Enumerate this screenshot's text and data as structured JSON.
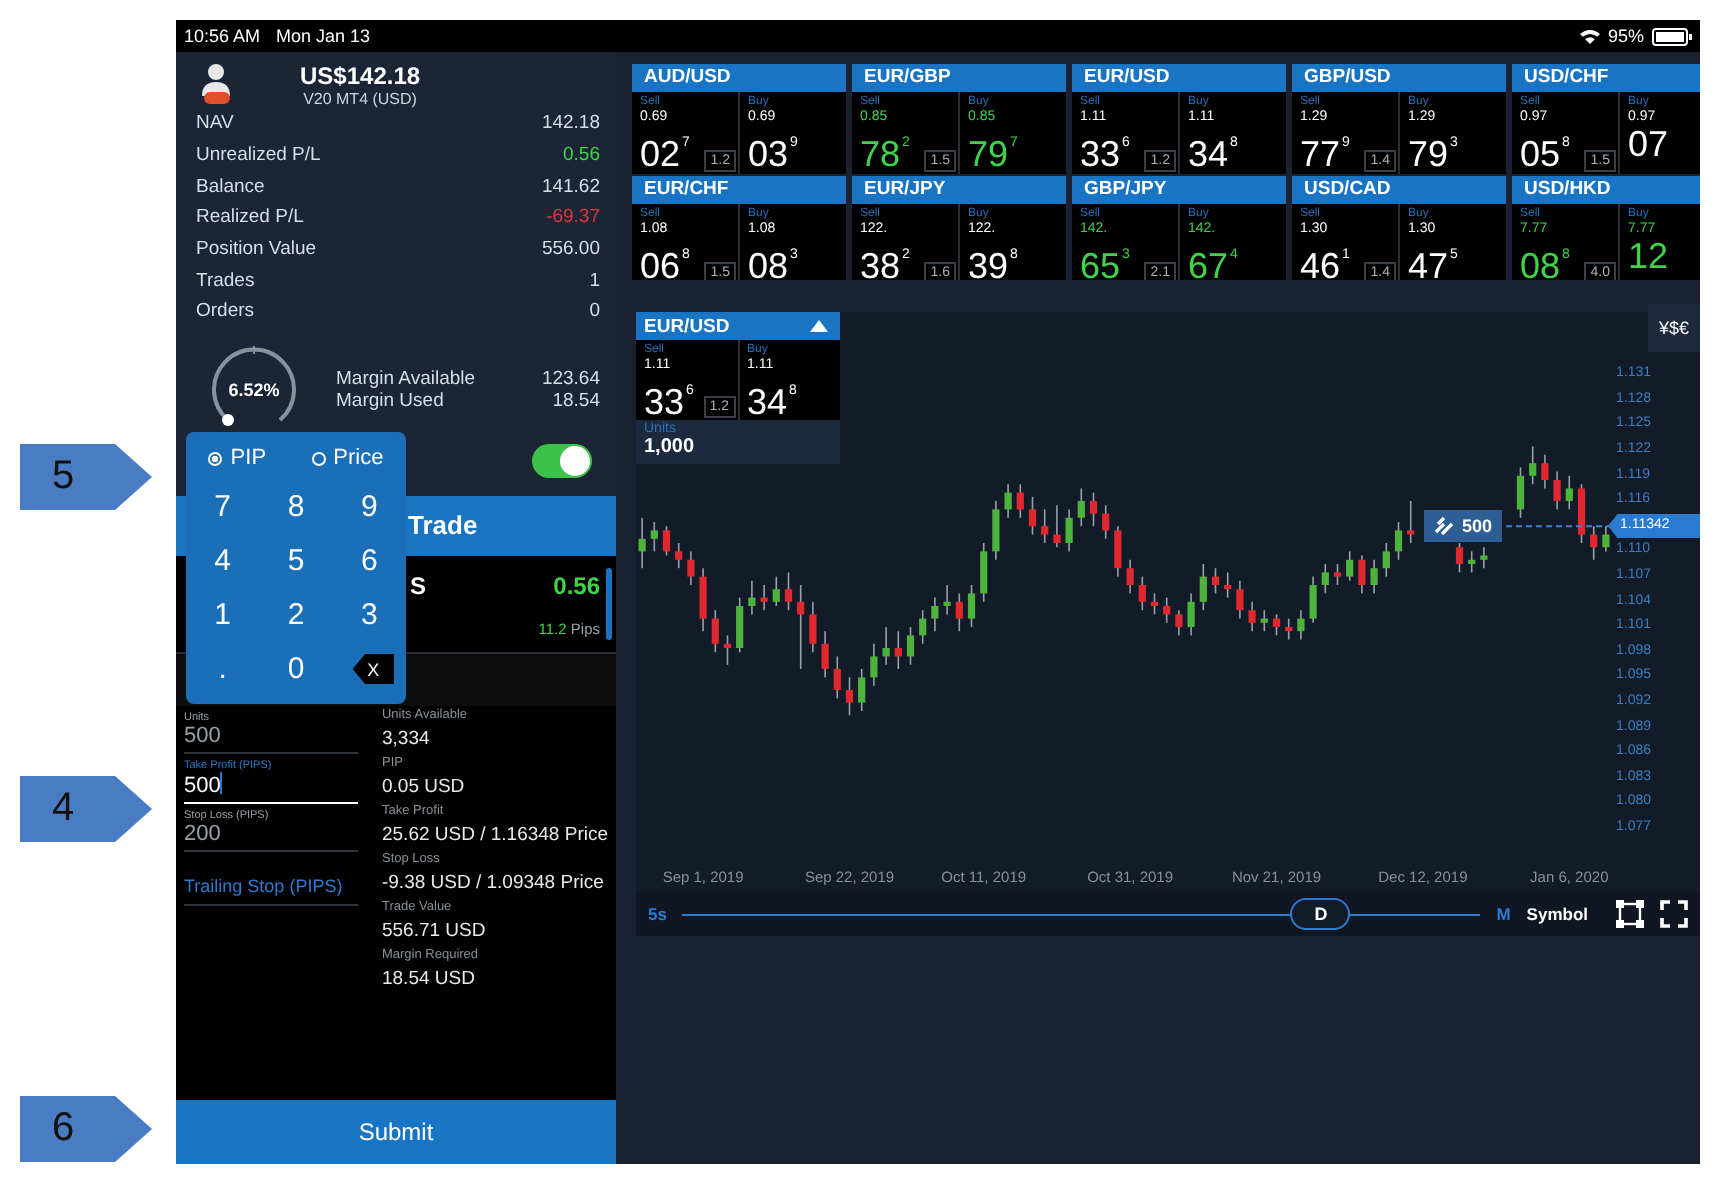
{
  "status_bar": {
    "time": "10:56 AM",
    "date": "Mon Jan 13",
    "battery": "95%"
  },
  "callouts": [
    {
      "label": "5"
    },
    {
      "label": "4"
    },
    {
      "label": "6"
    }
  ],
  "account": {
    "balance_title": "US$142.18",
    "account_name": "V20 MT4 (USD)",
    "rows": [
      {
        "label": "NAV",
        "value": "142.18",
        "color": "#d8dde6"
      },
      {
        "label": "Unrealized P/L",
        "value": "0.56",
        "color": "#3fd44a"
      },
      {
        "label": "Balance",
        "value": "141.62",
        "color": "#d8dde6"
      },
      {
        "label": "Realized P/L",
        "value": "-69.37",
        "color": "#e3343a"
      },
      {
        "label": "Position Value",
        "value": "556.00",
        "color": "#d8dde6"
      },
      {
        "label": "Trades",
        "value": "1",
        "color": "#d8dde6"
      },
      {
        "label": "Orders",
        "value": "0",
        "color": "#d8dde6"
      }
    ],
    "margin": {
      "percent": "6.52%",
      "items": [
        {
          "label": "Margin Available",
          "value": "123.64"
        },
        {
          "label": "Margin Used",
          "value": "18.54"
        }
      ]
    }
  },
  "toggle": {
    "on": true
  },
  "keypad": {
    "modes": [
      {
        "label": "PIP",
        "selected": true
      },
      {
        "label": "Price",
        "selected": false
      }
    ],
    "keys": [
      "7",
      "8",
      "9",
      "4",
      "5",
      "6",
      "1",
      "2",
      "3",
      ".",
      "0"
    ],
    "backspace": "X"
  },
  "trade": {
    "header": "Trade",
    "position_label": "S",
    "pl": "0.56",
    "pips_value": "11.2",
    "pips_unit": "Pips"
  },
  "order_form": {
    "fields": [
      {
        "label": "Units",
        "value": "500",
        "focused": false
      },
      {
        "label": "Take Profit (PIPS)",
        "value": "500",
        "focused": true
      },
      {
        "label": "Stop Loss (PIPS)",
        "value": "200",
        "focused": false
      }
    ],
    "trailing_stop": "Trailing Stop (PIPS)",
    "info": [
      {
        "label": "Units Available",
        "value": "3,334"
      },
      {
        "label": "PIP",
        "value": "0.05 USD"
      },
      {
        "label": "Take Profit",
        "value": "25.62 USD / 1.16348 Price"
      },
      {
        "label": "Stop Loss",
        "value": "-9.38 USD / 1.09348 Price"
      },
      {
        "label": "Trade Value",
        "value": "556.71 USD"
      },
      {
        "label": "Margin Required",
        "value": "18.54 USD"
      }
    ]
  },
  "submit": "Submit",
  "quotes": [
    {
      "pair": "AUD/USD",
      "rising": false,
      "spread": "1.2",
      "sell": {
        "label": "Sell",
        "prefix": "0.69",
        "big": "02",
        "pip": "7"
      },
      "buy": {
        "label": "Buy",
        "prefix": "0.69",
        "big": "03",
        "pip": "9"
      }
    },
    {
      "pair": "EUR/GBP",
      "rising": true,
      "spread": "1.5",
      "sell": {
        "label": "Sell",
        "prefix": "0.85",
        "big": "78",
        "pip": "2"
      },
      "buy": {
        "label": "Buy",
        "prefix": "0.85",
        "big": "79",
        "pip": "7"
      }
    },
    {
      "pair": "EUR/USD",
      "rising": false,
      "spread": "1.2",
      "sell": {
        "label": "Sell",
        "prefix": "1.11",
        "big": "33",
        "pip": "6"
      },
      "buy": {
        "label": "Buy",
        "prefix": "1.11",
        "big": "34",
        "pip": "8"
      }
    },
    {
      "pair": "GBP/USD",
      "rising": false,
      "spread": "1.4",
      "sell": {
        "label": "Sell",
        "prefix": "1.29",
        "big": "77",
        "pip": "9"
      },
      "buy": {
        "label": "Buy",
        "prefix": "1.29",
        "big": "79",
        "pip": "3"
      }
    },
    {
      "pair": "USD/CHF",
      "rising": false,
      "spread": "1.5",
      "sell": {
        "label": "Sell",
        "prefix": "0.97",
        "big": "05",
        "pip": "8"
      },
      "buy": {
        "label": "Buy",
        "prefix": "0.97",
        "big": "07"
      }
    },
    {
      "pair": "EUR/CHF",
      "rising": false,
      "spread": "1.5",
      "sell": {
        "label": "Sell",
        "prefix": "1.08",
        "big": "06",
        "pip": "8"
      },
      "buy": {
        "label": "Buy",
        "prefix": "1.08",
        "big": "08",
        "pip": "3"
      }
    },
    {
      "pair": "EUR/JPY",
      "rising": false,
      "spread": "1.6",
      "sell": {
        "label": "Sell",
        "prefix": "122.",
        "big": "38",
        "pip": "2"
      },
      "buy": {
        "label": "Buy",
        "prefix": "122.",
        "big": "39",
        "pip": "8"
      }
    },
    {
      "pair": "GBP/JPY",
      "rising": true,
      "spread": "2.1",
      "sell": {
        "label": "Sell",
        "prefix": "142.",
        "big": "65",
        "pip": "3"
      },
      "buy": {
        "label": "Buy",
        "prefix": "142.",
        "big": "67",
        "pip": "4"
      }
    },
    {
      "pair": "USD/CAD",
      "rising": false,
      "spread": "1.4",
      "sell": {
        "label": "Sell",
        "prefix": "1.30",
        "big": "46",
        "pip": "1"
      },
      "buy": {
        "label": "Buy",
        "prefix": "1.30",
        "big": "47",
        "pip": "5"
      }
    },
    {
      "pair": "USD/HKD",
      "rising": true,
      "spread": "4.0",
      "sell": {
        "label": "Sell",
        "prefix": "7.77",
        "big": "08",
        "pip": "8"
      },
      "buy": {
        "label": "Buy",
        "prefix": "7.77",
        "big": "12"
      }
    }
  ],
  "chart": {
    "ticket": {
      "pair": "EUR/USD",
      "spread": "1.2",
      "sell": {
        "label": "Sell",
        "prefix": "1.11",
        "big": "33",
        "pip": "6"
      },
      "buy": {
        "label": "Buy",
        "prefix": "1.11",
        "big": "34",
        "pip": "8"
      },
      "units_label": "Units",
      "units": "1,000"
    },
    "currency_button": "¥$€",
    "price_tag": "1.11342",
    "position_marker": "500",
    "timeframe": {
      "min": "5s",
      "current": "D",
      "max": "M",
      "level": 0.8
    },
    "symbol": "Symbol",
    "chart_data": {
      "type": "candlestick",
      "ylim": [
        1.077,
        1.131
      ],
      "categories": [
        null,
        null,
        null,
        null,
        null,
        "Sep 1, 2019",
        null,
        null,
        null,
        null,
        null,
        null,
        null,
        null,
        null,
        null,
        null,
        "Sep 22, 2019",
        null,
        null,
        null,
        null,
        null,
        null,
        null,
        null,
        null,
        null,
        "Oct 11, 2019",
        null,
        null,
        null,
        null,
        null,
        null,
        null,
        null,
        null,
        null,
        null,
        "Oct 31, 2019",
        null,
        null,
        null,
        null,
        null,
        null,
        null,
        null,
        null,
        null,
        null,
        "Nov 21, 2019",
        null,
        null,
        null,
        null,
        null,
        null,
        null,
        null,
        null,
        null,
        null,
        "Dec 12, 2019",
        null,
        null,
        null,
        null,
        null,
        null,
        null,
        null,
        null,
        null,
        null,
        "Jan 6, 2020",
        null,
        null,
        null
      ],
      "yticks": [
        {
          "value": 1.131,
          "label": "1.131"
        },
        {
          "value": 1.128,
          "label": "1.128"
        },
        {
          "value": 1.125,
          "label": "1.125"
        },
        {
          "value": 1.122,
          "label": "1.122"
        },
        {
          "value": 1.119,
          "label": "1.119"
        },
        {
          "value": 1.116,
          "label": "1.116"
        },
        {
          "value": 1.11,
          "label": "1.110"
        },
        {
          "value": 1.107,
          "label": "1.107"
        },
        {
          "value": 1.104,
          "label": "1.104"
        },
        {
          "value": 1.101,
          "label": "1.101"
        },
        {
          "value": 1.098,
          "label": "1.098"
        },
        {
          "value": 1.095,
          "label": "1.095"
        },
        {
          "value": 1.092,
          "label": "1.092"
        },
        {
          "value": 1.089,
          "label": "1.089"
        },
        {
          "value": 1.086,
          "label": "1.086"
        },
        {
          "value": 1.083,
          "label": "1.083"
        },
        {
          "value": 1.08,
          "label": "1.080"
        },
        {
          "value": 1.077,
          "label": "1.077"
        }
      ],
      "ohlc": [
        [
          1.11,
          1.114,
          1.108,
          1.1115
        ],
        [
          1.1115,
          1.1135,
          1.11,
          1.1125
        ],
        [
          1.1125,
          1.113,
          1.1095,
          1.11
        ],
        [
          1.11,
          1.111,
          1.108,
          1.109
        ],
        [
          1.109,
          1.11,
          1.106,
          1.107
        ],
        [
          1.107,
          1.108,
          1.1005,
          1.102
        ],
        [
          1.102,
          1.103,
          1.098,
          1.099
        ],
        [
          1.099,
          1.1,
          1.0965,
          1.0985
        ],
        [
          1.0985,
          1.1045,
          1.098,
          1.1035
        ],
        [
          1.1035,
          1.1065,
          1.1025,
          1.1045
        ],
        [
          1.1045,
          1.106,
          1.103,
          1.104
        ],
        [
          1.104,
          1.107,
          1.1035,
          1.1055
        ],
        [
          1.1055,
          1.1075,
          1.103,
          1.104
        ],
        [
          1.104,
          1.106,
          1.096,
          1.1025
        ],
        [
          1.1025,
          1.104,
          1.098,
          1.099
        ],
        [
          1.099,
          1.1005,
          1.095,
          1.096
        ],
        [
          1.096,
          1.0975,
          1.0925,
          1.0935
        ],
        [
          1.0935,
          1.095,
          1.0905,
          1.092
        ],
        [
          1.092,
          1.096,
          1.091,
          1.095
        ],
        [
          1.095,
          1.099,
          1.094,
          1.0975
        ],
        [
          1.0975,
          1.101,
          1.0965,
          1.0985
        ],
        [
          1.0985,
          1.1005,
          1.096,
          1.0975
        ],
        [
          1.0975,
          1.101,
          1.0965,
          1.1
        ],
        [
          1.1,
          1.103,
          1.099,
          1.102
        ],
        [
          1.102,
          1.1045,
          1.1005,
          1.1035
        ],
        [
          1.1035,
          1.106,
          1.1025,
          1.104
        ],
        [
          1.104,
          1.105,
          1.1005,
          1.102
        ],
        [
          1.102,
          1.106,
          1.101,
          1.105
        ],
        [
          1.105,
          1.111,
          1.104,
          1.11
        ],
        [
          1.11,
          1.116,
          1.109,
          1.115
        ],
        [
          1.115,
          1.118,
          1.114,
          1.117
        ],
        [
          1.117,
          1.118,
          1.114,
          1.115
        ],
        [
          1.115,
          1.1165,
          1.112,
          1.113
        ],
        [
          1.113,
          1.115,
          1.111,
          1.112
        ],
        [
          1.112,
          1.1155,
          1.1105,
          1.111
        ],
        [
          1.111,
          1.115,
          1.11,
          1.114
        ],
        [
          1.114,
          1.1175,
          1.113,
          1.116
        ],
        [
          1.116,
          1.117,
          1.113,
          1.1145
        ],
        [
          1.1145,
          1.1155,
          1.1115,
          1.1125
        ],
        [
          1.1125,
          1.113,
          1.107,
          1.108
        ],
        [
          1.108,
          1.109,
          1.105,
          1.106
        ],
        [
          1.106,
          1.107,
          1.103,
          1.104
        ],
        [
          1.104,
          1.105,
          1.1025,
          1.1035
        ],
        [
          1.1035,
          1.1045,
          1.1015,
          1.1025
        ],
        [
          1.1025,
          1.103,
          1.1,
          1.101
        ],
        [
          1.101,
          1.105,
          1.1,
          1.104
        ],
        [
          1.104,
          1.1085,
          1.103,
          1.107
        ],
        [
          1.107,
          1.108,
          1.105,
          1.106
        ],
        [
          1.106,
          1.1075,
          1.1045,
          1.1055
        ],
        [
          1.1055,
          1.1065,
          1.102,
          1.103
        ],
        [
          1.103,
          1.104,
          1.1005,
          1.1015
        ],
        [
          1.1015,
          1.103,
          1.1005,
          1.102
        ],
        [
          1.102,
          1.1025,
          1.1,
          1.101
        ],
        [
          1.101,
          1.102,
          1.0995,
          1.1005
        ],
        [
          1.1005,
          1.103,
          1.0995,
          1.102
        ],
        [
          1.102,
          1.107,
          1.1015,
          1.106
        ],
        [
          1.106,
          1.1085,
          1.105,
          1.1075
        ],
        [
          1.1075,
          1.1085,
          1.106,
          1.107
        ],
        [
          1.107,
          1.11,
          1.1065,
          1.109
        ],
        [
          1.109,
          1.1095,
          1.105,
          1.106
        ],
        [
          1.106,
          1.109,
          1.105,
          1.108
        ],
        [
          1.108,
          1.111,
          1.107,
          1.11
        ],
        [
          1.11,
          1.1135,
          1.109,
          1.1125
        ],
        [
          1.1125,
          1.116,
          1.111,
          1.112
        ],
        null,
        null,
        null,
        [
          1.1105,
          1.111,
          1.1075,
          1.1085
        ],
        [
          1.1085,
          1.11,
          1.1075,
          1.109
        ],
        [
          1.109,
          1.1105,
          1.108,
          1.1095
        ],
        null,
        null,
        [
          1.115,
          1.12,
          1.114,
          1.119
        ],
        [
          1.119,
          1.1225,
          1.118,
          1.1205
        ],
        [
          1.1205,
          1.1215,
          1.1175,
          1.1185
        ],
        [
          1.1185,
          1.1195,
          1.115,
          1.116
        ],
        [
          1.116,
          1.119,
          1.115,
          1.1175
        ],
        [
          1.1175,
          1.118,
          1.111,
          1.112
        ],
        [
          1.112,
          1.113,
          1.109,
          1.1105
        ],
        [
          1.1105,
          1.113,
          1.11,
          1.112
        ]
      ]
    }
  }
}
